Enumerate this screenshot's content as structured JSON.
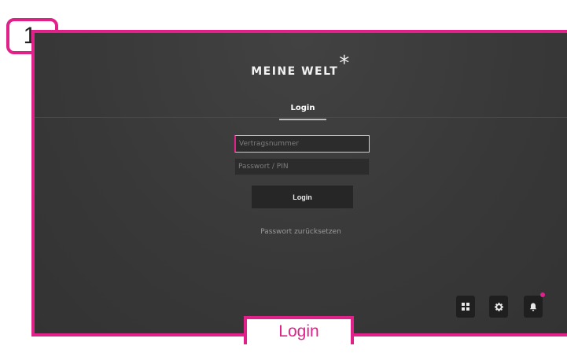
{
  "colors": {
    "accent": "#e0218a",
    "screen_bg": "#3a3a3a",
    "input_bg": "#2c2c2c",
    "button_bg": "#262626"
  },
  "annotation": {
    "step_number": "1",
    "caption": "Login"
  },
  "app": {
    "logo_text": "MEINE WELT",
    "logo_mark": "*"
  },
  "tabs": [
    {
      "label": "Login",
      "active": true
    }
  ],
  "form": {
    "contract_number": {
      "placeholder": "Vertragsnummer",
      "value": ""
    },
    "password": {
      "placeholder": "Passwort / PIN",
      "value": ""
    },
    "submit_label": "Login",
    "reset_link": "Passwort zurücksetzen"
  },
  "toolbar": {
    "icons": [
      "grid-icon",
      "gear-icon",
      "bell-icon"
    ]
  }
}
